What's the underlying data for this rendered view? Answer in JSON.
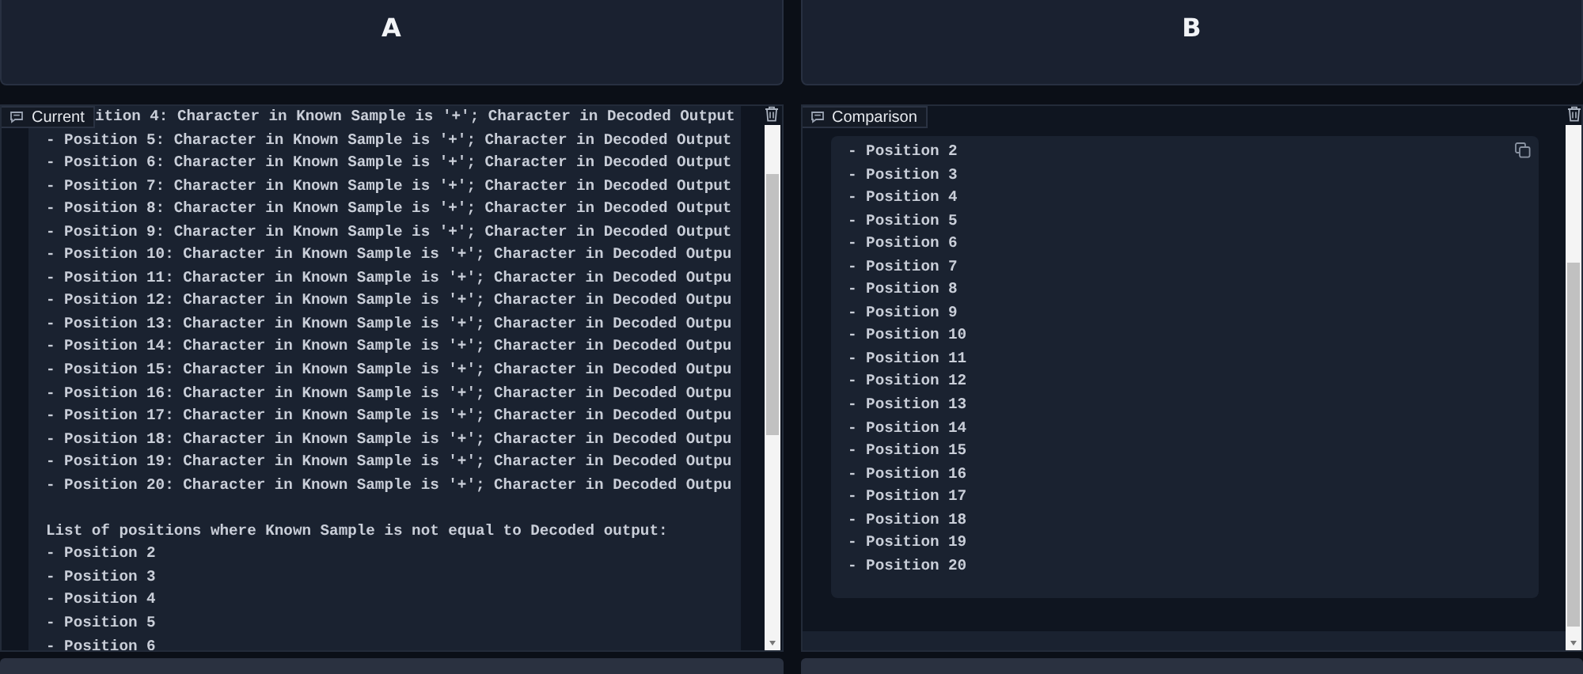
{
  "headers": [
    {
      "label": "A"
    },
    {
      "label": "B"
    }
  ],
  "panels": [
    {
      "label": "Current",
      "kind": "plain",
      "blocks": [
        [
          "ition 4: Character in Known Sample is '+'; Character in Decoded Output",
          "- Position 5: Character in Known Sample is '+'; Character in Decoded Output",
          "- Position 6: Character in Known Sample is '+'; Character in Decoded Output",
          "- Position 7: Character in Known Sample is '+'; Character in Decoded Output",
          "- Position 8: Character in Known Sample is '+'; Character in Decoded Output",
          "- Position 9: Character in Known Sample is '+'; Character in Decoded Output",
          "- Position 10: Character in Known Sample is '+'; Character in Decoded Outpu",
          "- Position 11: Character in Known Sample is '+'; Character in Decoded Outpu",
          "- Position 12: Character in Known Sample is '+'; Character in Decoded Outpu",
          "- Position 13: Character in Known Sample is '+'; Character in Decoded Outpu",
          "- Position 14: Character in Known Sample is '+'; Character in Decoded Outpu",
          "- Position 15: Character in Known Sample is '+'; Character in Decoded Outpu",
          "- Position 16: Character in Known Sample is '+'; Character in Decoded Outpu",
          "- Position 17: Character in Known Sample is '+'; Character in Decoded Outpu",
          "- Position 18: Character in Known Sample is '+'; Character in Decoded Outpu",
          "- Position 19: Character in Known Sample is '+'; Character in Decoded Outpu",
          "- Position 20: Character in Known Sample is '+'; Character in Decoded Outpu"
        ],
        [
          "List of positions where Known Sample is not equal to Decoded output:",
          "- Position 2",
          "- Position 3",
          "- Position 4",
          "- Position 5",
          "- Position 6"
        ]
      ]
    },
    {
      "label": "Comparison",
      "kind": "boxed",
      "blocks": [
        [
          "- Position 2",
          "- Position 3",
          "- Position 4",
          "- Position 5",
          "- Position 6",
          "- Position 7",
          "- Position 8",
          "- Position 9",
          "- Position 10",
          "- Position 11",
          "- Position 12",
          "- Position 13",
          "- Position 14",
          "- Position 15",
          "- Position 16",
          "- Position 17",
          "- Position 18",
          "- Position 19",
          "- Position 20"
        ]
      ]
    }
  ]
}
